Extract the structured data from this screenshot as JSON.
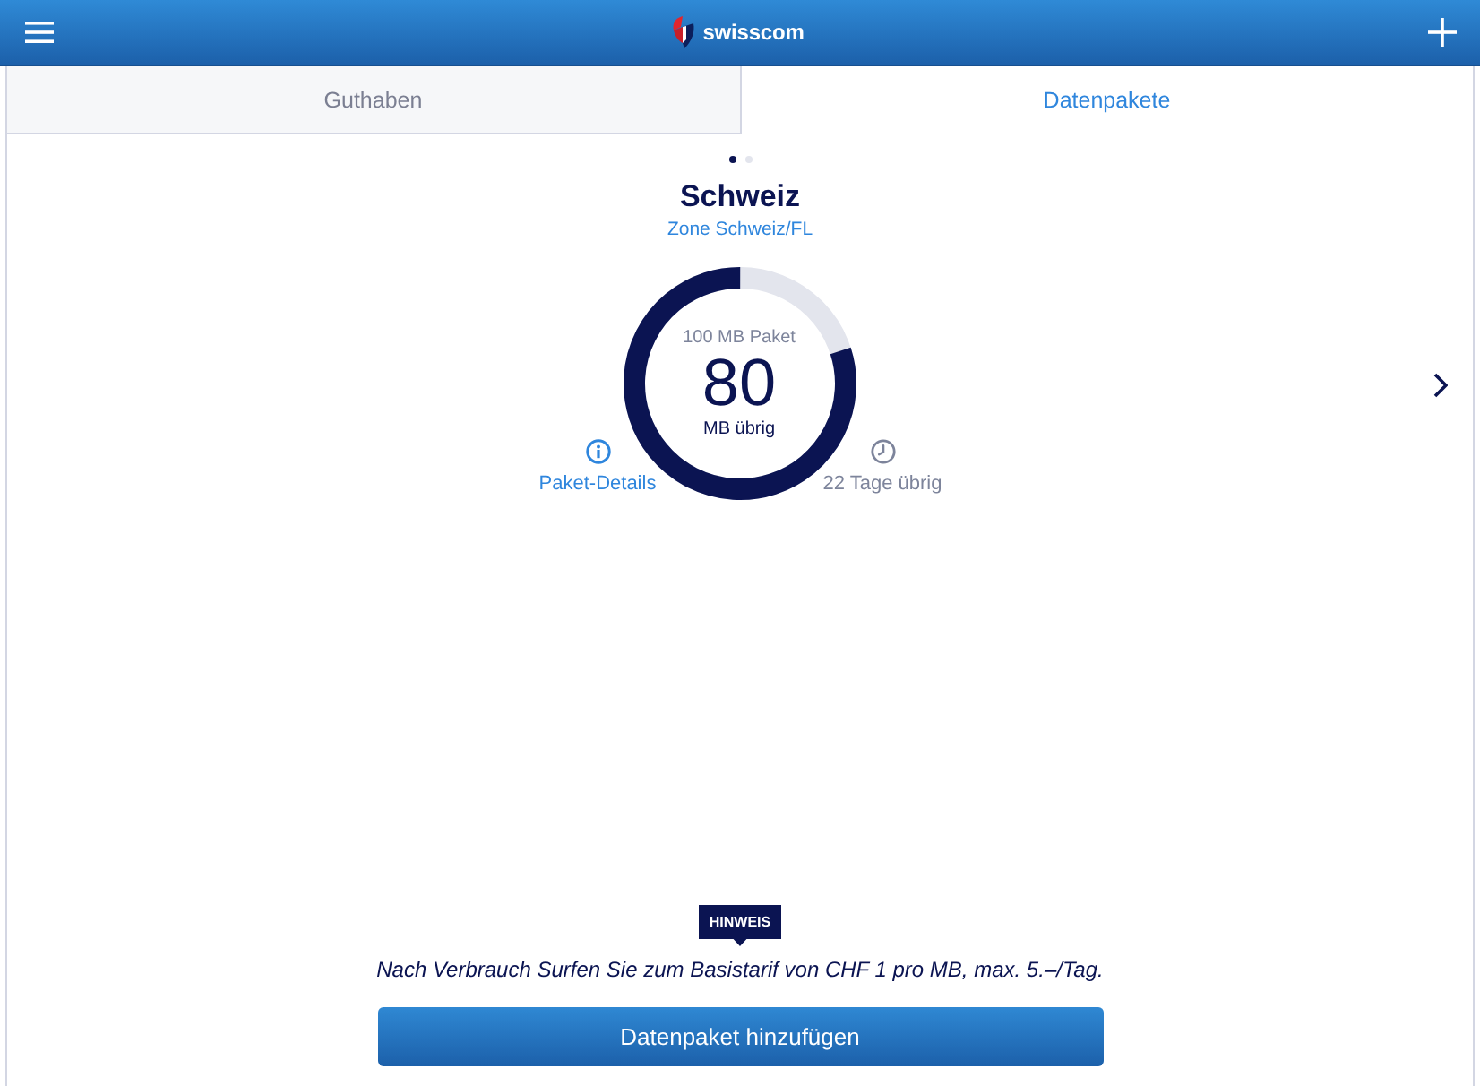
{
  "header": {
    "logo_text": "swisscom"
  },
  "tabs": [
    {
      "label": "Guthaben",
      "selected": false
    },
    {
      "label": "Datenpakete",
      "selected": true
    }
  ],
  "pager": [
    {
      "selected": true
    },
    {
      "selected": false
    }
  ],
  "package": {
    "title": "Schweiz",
    "zone": "Zone Schweiz/FL",
    "size": "100 MB Paket",
    "remaining": "80",
    "unit": "MB übrig",
    "level": 0.8,
    "details_link": "Paket-Details",
    "days_left": "22 Tage übrig"
  },
  "notice": {
    "badge": "HINWEIS",
    "text": "Nach Verbrauch Surfen Sie zum Basistarif von CHF 1 pro MB, max. 5.–/Tag."
  },
  "button": "Datenpaket hinzufügen"
}
